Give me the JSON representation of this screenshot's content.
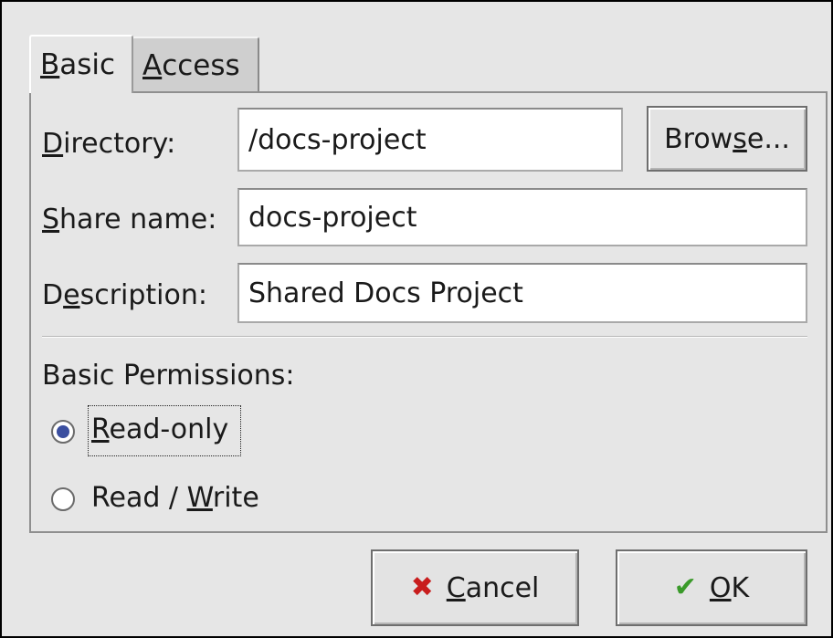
{
  "tabs": [
    {
      "label": "Basic",
      "mnemonic": "B",
      "rest": "asic"
    },
    {
      "label": "Access",
      "mnemonic": "A",
      "rest": "ccess"
    }
  ],
  "fields": {
    "directory": {
      "label_pre": "",
      "mnemonic": "D",
      "label_post": "irectory:",
      "value": "/docs-project"
    },
    "share_name": {
      "label_pre": "",
      "mnemonic": "S",
      "label_post": "hare name:",
      "value": "docs-project"
    },
    "description": {
      "label_pre": "D",
      "mnemonic": "e",
      "label_post": "scription:",
      "value": "Shared Docs Project"
    }
  },
  "browse_button": {
    "pre": "Brow",
    "mnemonic": "s",
    "post": "e..."
  },
  "permissions": {
    "heading": "Basic Permissions:",
    "options": [
      {
        "pre": "",
        "mnemonic": "R",
        "post": "ead-only",
        "checked": true
      },
      {
        "pre": "Read / ",
        "mnemonic": "W",
        "post": "rite",
        "checked": false
      }
    ]
  },
  "buttons": {
    "cancel": {
      "icon": "cancel-icon",
      "mnemonic": "C",
      "post": "ancel"
    },
    "ok": {
      "icon": "ok-icon",
      "mnemonic": "O",
      "post": "K"
    }
  },
  "colors": {
    "dialog_bg": "#e6e6e6",
    "radio_checked": "#3b4fa0",
    "cancel_icon": "#c81d1d",
    "ok_icon": "#3a9a2a"
  }
}
